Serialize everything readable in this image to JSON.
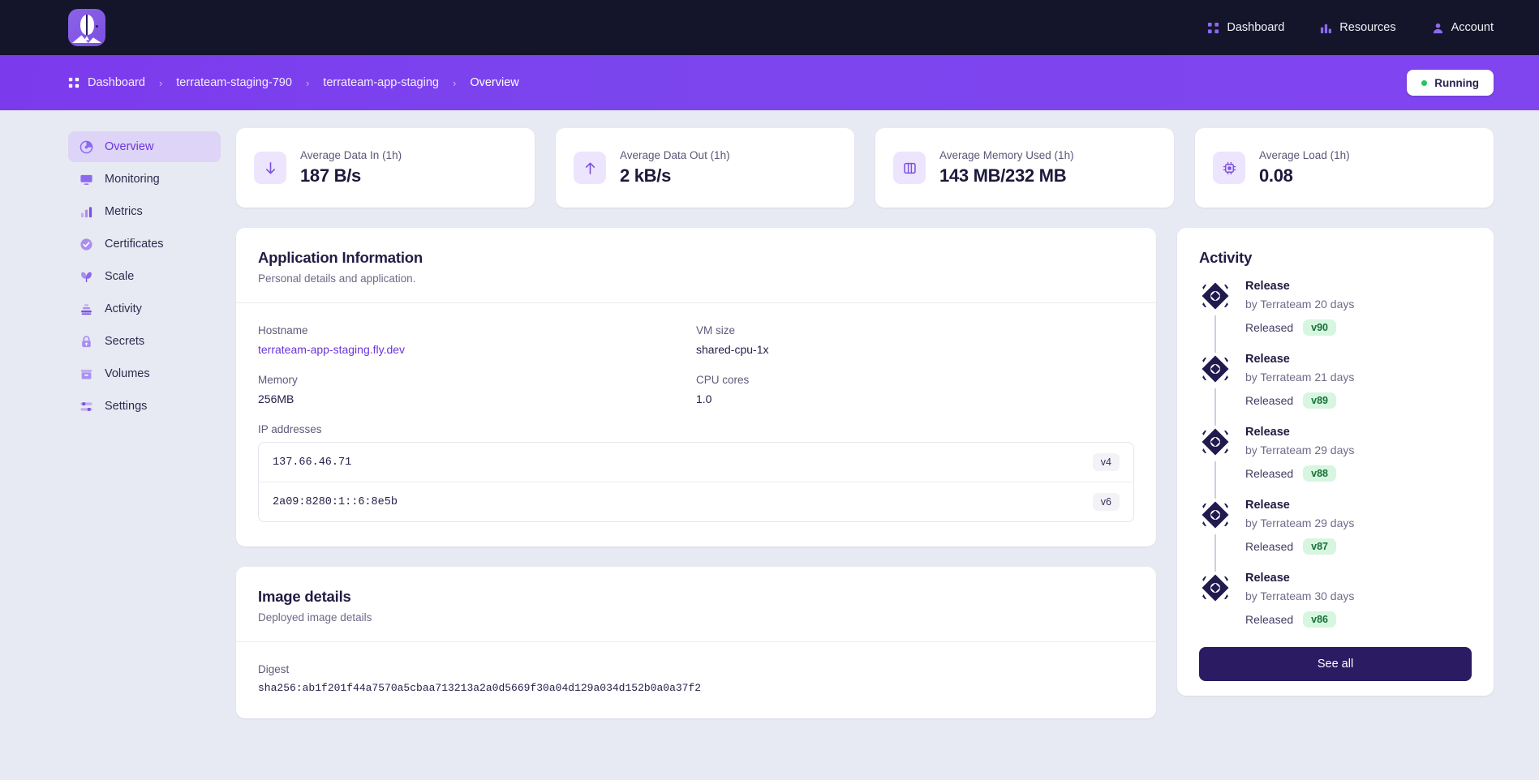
{
  "topbar": {
    "logo_name": "fly-balloon-logo",
    "nav": [
      {
        "label": "Dashboard",
        "icon": "grid-icon"
      },
      {
        "label": "Resources",
        "icon": "bar-chart-icon"
      },
      {
        "label": "Account",
        "icon": "user-icon"
      }
    ]
  },
  "breadcrumb": {
    "items": [
      {
        "label": "Dashboard"
      },
      {
        "label": "terrateam-staging-790"
      },
      {
        "label": "terrateam-app-staging"
      },
      {
        "label": "Overview"
      }
    ],
    "separator": "›",
    "status": {
      "label": "Running",
      "color": "#22c55e"
    }
  },
  "sidebar": {
    "items": [
      {
        "label": "Overview",
        "icon": "pie-chart-icon",
        "active": true
      },
      {
        "label": "Monitoring",
        "icon": "monitor-icon",
        "active": false
      },
      {
        "label": "Metrics",
        "icon": "bar-chart-icon",
        "active": false
      },
      {
        "label": "Certificates",
        "icon": "check-badge-icon",
        "active": false
      },
      {
        "label": "Scale",
        "icon": "leaf-icon",
        "active": false
      },
      {
        "label": "Activity",
        "icon": "stack-icon",
        "active": false
      },
      {
        "label": "Secrets",
        "icon": "lock-icon",
        "active": false
      },
      {
        "label": "Volumes",
        "icon": "archive-icon",
        "active": false
      },
      {
        "label": "Settings",
        "icon": "sliders-icon",
        "active": false
      }
    ]
  },
  "stats": [
    {
      "label": "Average Data In (1h)",
      "value": "187 B/s",
      "icon": "arrow-down-icon"
    },
    {
      "label": "Average Data Out (1h)",
      "value": "2 kB/s",
      "icon": "arrow-up-icon"
    },
    {
      "label": "Average Memory Used (1h)",
      "value": "143 MB/232 MB",
      "icon": "memory-icon"
    },
    {
      "label": "Average Load (1h)",
      "value": "0.08",
      "icon": "cpu-icon"
    }
  ],
  "app_info": {
    "title": "Application Information",
    "subtitle": "Personal details and application.",
    "fields": [
      {
        "label": "Hostname",
        "value": "terrateam-app-staging.fly.dev",
        "link": true
      },
      {
        "label": "VM size",
        "value": "shared-cpu-1x",
        "link": false
      },
      {
        "label": "Memory",
        "value": "256MB",
        "link": false
      },
      {
        "label": "CPU cores",
        "value": "1.0",
        "link": false
      }
    ],
    "ip_label": "IP addresses",
    "ips": [
      {
        "address": "137.66.46.71",
        "version": "v4"
      },
      {
        "address": "2a09:8280:1::6:8e5b",
        "version": "v6"
      }
    ]
  },
  "image_details": {
    "title": "Image details",
    "subtitle": "Deployed image details",
    "digest_label": "Digest",
    "digest_value": "sha256:ab1f201f44a7570a5cbaa713213a2a0d5669f30a04d129a034d152b0a0a37f2"
  },
  "activity": {
    "title": "Activity",
    "items": [
      {
        "title": "Release",
        "by": "by Terrateam 20 days",
        "released_label": "Released",
        "version": "v90"
      },
      {
        "title": "Release",
        "by": "by Terrateam 21 days",
        "released_label": "Released",
        "version": "v89"
      },
      {
        "title": "Release",
        "by": "by Terrateam 29 days",
        "released_label": "Released",
        "version": "v88"
      },
      {
        "title": "Release",
        "by": "by Terrateam 29 days",
        "released_label": "Released",
        "version": "v87"
      },
      {
        "title": "Release",
        "by": "by Terrateam 30 days",
        "released_label": "Released",
        "version": "v86"
      }
    ],
    "see_all_label": "See all"
  },
  "colors": {
    "accent": "#7c3aed",
    "header_bg": "#14142b",
    "page_bg": "#e8eaf3",
    "status_green": "#22c55e",
    "badge_green_bg": "#d7f6df",
    "badge_green_text": "#18703c",
    "link": "#6a35d9",
    "dark_button": "#2b1b63"
  }
}
